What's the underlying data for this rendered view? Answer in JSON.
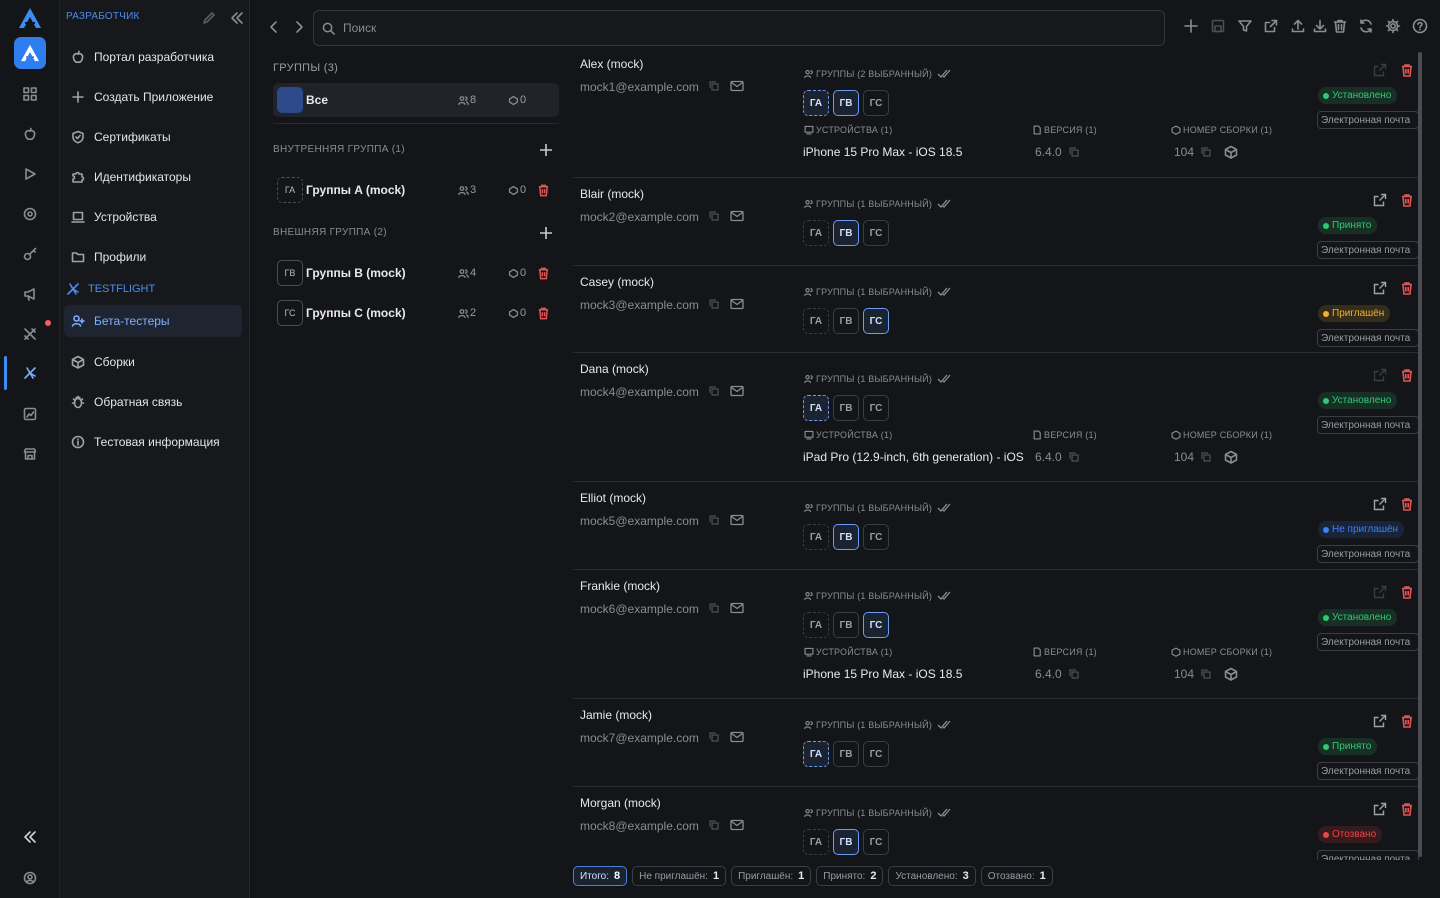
{
  "app": {
    "section_title": "РАЗРАБОТЧИК",
    "testflight_label": "TESTFLIGHT"
  },
  "nav": {
    "portal": "Портал разработчика",
    "create_app": "Создать Приложение",
    "certificates": "Сертификаты",
    "identifiers": "Идентификаторы",
    "devices": "Устройства",
    "profiles": "Профили",
    "beta_testers": "Бета-тестеры",
    "builds": "Сборки",
    "feedback": "Обратная связь",
    "test_info": "Тестовая информация"
  },
  "search": {
    "placeholder": "Поиск"
  },
  "groups": {
    "title": "ГРУППЫ (3)",
    "all": {
      "name": "Все",
      "testers": "8",
      "devices": "0"
    },
    "internal_header": "ВНУТРЕННЯЯ ГРУППА (1)",
    "external_header": "ВНЕШНЯЯ ГРУППА (2)",
    "items": [
      {
        "badge": "ГА",
        "name": "Группы A (mock)",
        "testers": "3",
        "devices": "0"
      },
      {
        "badge": "ГВ",
        "name": "Группы B (mock)",
        "testers": "4",
        "devices": "0"
      },
      {
        "badge": "ГС",
        "name": "Группы C (mock)",
        "testers": "2",
        "devices": "0"
      }
    ]
  },
  "labels": {
    "groups2": "ГРУППЫ (2 ВЫБРАННЫЙ)",
    "groups1": "ГРУППЫ (1 ВЫБРАННЫЙ)",
    "devices": "УСТРОЙСТВА (1)",
    "version": "ВЕРСИЯ (1)",
    "build": "НОМЕР СБОРКИ (1)",
    "email_tag": "Электронная почта",
    "chip_a": "ГА",
    "chip_b": "ГВ",
    "chip_c": "ГС"
  },
  "testers": [
    {
      "name": "Alex (mock)",
      "email": "mock1@example.com",
      "status": "Установлено",
      "status_color": "#2ecc71",
      "device": "iPhone 15 Pro Max - iOS 18.5",
      "version": "6.4.0",
      "build": "104"
    },
    {
      "name": "Blair (mock)",
      "email": "mock2@example.com",
      "status": "Принято",
      "status_color": "#2ecc71"
    },
    {
      "name": "Casey (mock)",
      "email": "mock3@example.com",
      "status": "Приглашён",
      "status_color": "#f0b429"
    },
    {
      "name": "Dana (mock)",
      "email": "mock4@example.com",
      "status": "Установлено",
      "status_color": "#2ecc71",
      "device": "iPad Pro (12.9-inch, 6th generation) - iOS",
      "version": "6.4.0",
      "build": "104"
    },
    {
      "name": "Elliot (mock)",
      "email": "mock5@example.com",
      "status": "Не приглашён",
      "status_color": "#3b82f6"
    },
    {
      "name": "Frankie (mock)",
      "email": "mock6@example.com",
      "status": "Установлено",
      "status_color": "#2ecc71",
      "device": "iPhone 15 Pro Max - iOS 18.5",
      "version": "6.4.0",
      "build": "104"
    },
    {
      "name": "Jamie (mock)",
      "email": "mock7@example.com",
      "status": "Принято",
      "status_color": "#2ecc71"
    },
    {
      "name": "Morgan (mock)",
      "email": "mock8@example.com",
      "status": "Отозвано",
      "status_color": "#ef4444"
    }
  ],
  "summary": {
    "total_label": "Итого:",
    "total": "8",
    "not_invited_label": "Не приглашён:",
    "not_invited": "1",
    "invited_label": "Приглашён:",
    "invited": "1",
    "accepted_label": "Принято:",
    "accepted": "2",
    "installed_label": "Установлено:",
    "installed": "3",
    "revoked_label": "Отозвано:",
    "revoked": "1"
  }
}
